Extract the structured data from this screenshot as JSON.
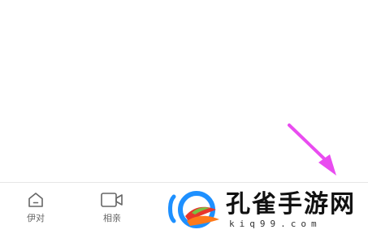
{
  "tab_bar": {
    "tabs": [
      {
        "label": "伊对",
        "icon": "home-icon"
      },
      {
        "label": "相亲",
        "icon": "video-camera-icon"
      }
    ]
  },
  "overlay": {
    "arrow_color": "#e94cf0",
    "arrow_icon": "arrow-icon"
  },
  "watermark": {
    "title": "孔雀手游网",
    "domain": "kiq99.com",
    "logo_icon": "peacock-logo-icon",
    "colors": {
      "blue": "#1e90ff",
      "orange": "#ff7a1a",
      "red": "#e8352b",
      "green": "#7ac143"
    }
  }
}
